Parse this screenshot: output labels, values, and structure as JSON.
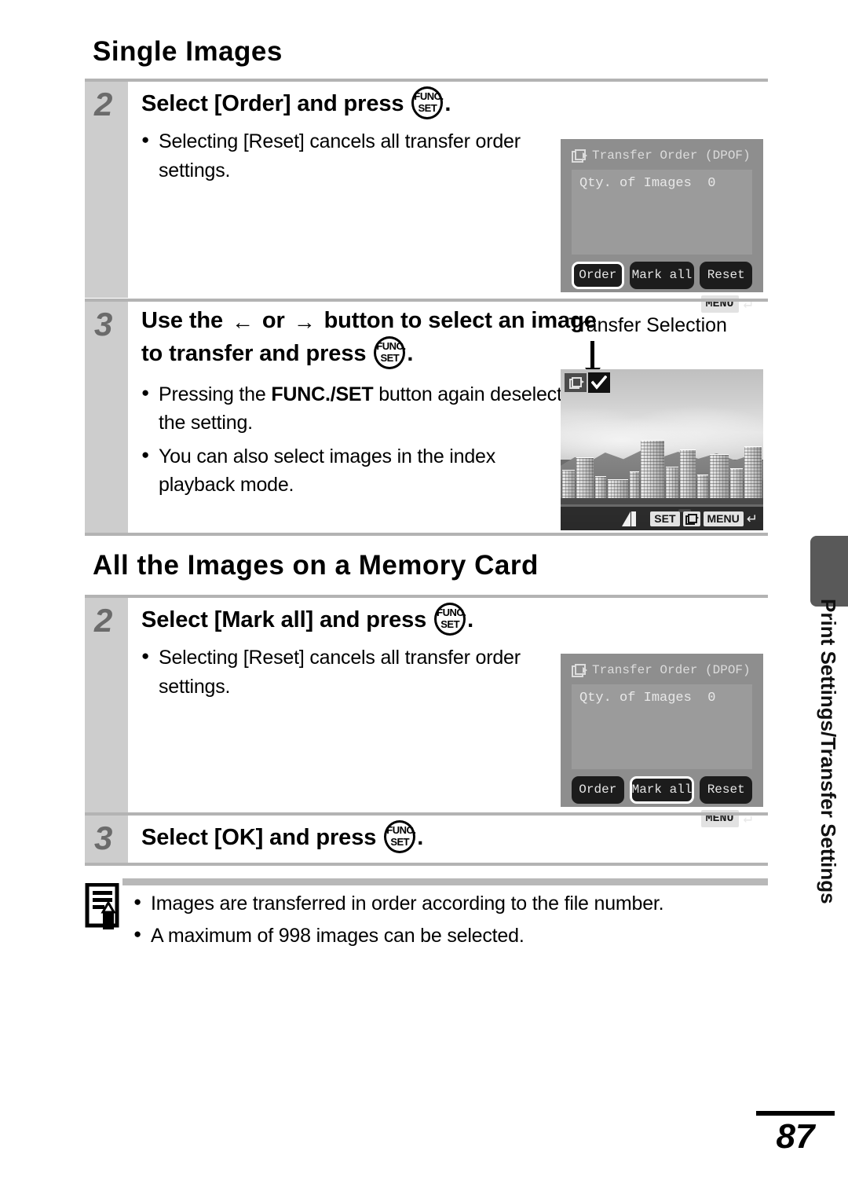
{
  "page": {
    "number": "87",
    "side_tab_label": "Print Settings/Transfer Settings"
  },
  "sections": [
    {
      "heading": "Single Images",
      "steps": [
        {
          "number": "2",
          "title_pre": "Select [Order] and press",
          "title_post": ".",
          "bullets": [
            "Selecting [Reset] cancels all transfer order settings."
          ]
        },
        {
          "number": "3",
          "title_a": "Use the",
          "title_b": "or",
          "title_c": "button to select an image to transfer and press",
          "title_post": ".",
          "bullets": [
            "Pressing the FUNC./SET button again deselects the setting.",
            "You can also select images in the index playback mode."
          ],
          "bullet_bold_terms": [
            "FUNC./SET"
          ]
        }
      ]
    },
    {
      "heading": "All the Images on a Memory Card",
      "steps": [
        {
          "number": "2",
          "title_pre": "Select [Mark all] and press",
          "title_post": ".",
          "bullets": [
            "Selecting [Reset] cancels all transfer order settings."
          ]
        },
        {
          "number": "3",
          "title_pre": "Select [OK] and press",
          "title_post": ".",
          "bullets": []
        }
      ]
    }
  ],
  "lcd_screens": [
    {
      "title": "Transfer Order (DPOF)",
      "panel_row": "Qty. of Images  0",
      "buttons": [
        {
          "label": "Order",
          "selected": true
        },
        {
          "label": "Mark all",
          "selected": false
        },
        {
          "label": "Reset",
          "selected": false
        }
      ],
      "menu_chip": "MENU",
      "return_glyph": "↵"
    },
    {
      "title": "Transfer Order (DPOF)",
      "panel_row": "Qty. of Images  0",
      "buttons": [
        {
          "label": "Order",
          "selected": false
        },
        {
          "label": "Mark all",
          "selected": true
        },
        {
          "label": "Reset",
          "selected": false
        }
      ],
      "menu_chip": "MENU",
      "return_glyph": "↵"
    }
  ],
  "transfer_selection": {
    "callout_label": "Transfer Selection",
    "bottom_bar": {
      "set_chip": "SET",
      "menu_chip": "MENU",
      "return_glyph": "↵"
    }
  },
  "note": {
    "bullets": [
      "Images are transferred in order according to the file number.",
      "A maximum of 998 images can be selected."
    ]
  },
  "glyphs": {
    "funcset_top": "FUNC.",
    "funcset_bottom": "SET",
    "arrow_left": "←",
    "arrow_right": "→"
  },
  "colors": {
    "step_column": "#cdcdcd",
    "step_number": "#6b6b6b",
    "rule": "#b3b3b3",
    "lcd_bg": "#8e8e8e",
    "lcd_panel": "#9b9b9b",
    "lcd_button": "#1c1c1c",
    "side_tab": "#595959"
  }
}
